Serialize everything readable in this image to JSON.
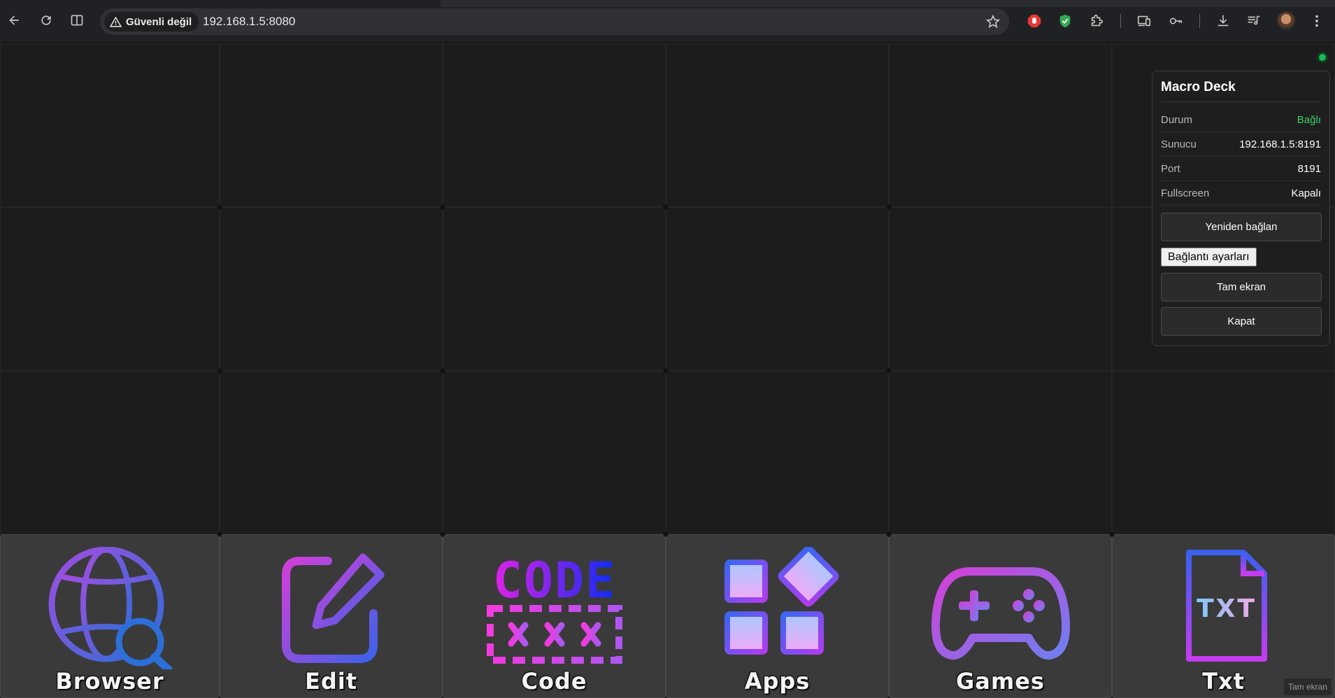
{
  "browser": {
    "security_label": "Güvenli değil",
    "url": "192.168.1.5:8080"
  },
  "deck": {
    "buttons": [
      {
        "label": "Browser",
        "icon": "globe-search-icon"
      },
      {
        "label": "Edit",
        "icon": "edit-icon"
      },
      {
        "label": "Code",
        "icon": "code-icon",
        "icon_text": "CODE"
      },
      {
        "label": "Apps",
        "icon": "apps-icon"
      },
      {
        "label": "Games",
        "icon": "gamepad-icon"
      },
      {
        "label": "Txt",
        "icon": "txt-file-icon",
        "icon_text": "TXT"
      }
    ]
  },
  "panel": {
    "title": "Macro Deck",
    "rows": [
      {
        "key": "Durum",
        "value": "Bağlı",
        "status_color": "#3ccf6a"
      },
      {
        "key": "Sunucu",
        "value": "192.168.1.5:8191"
      },
      {
        "key": "Port",
        "value": "8191"
      },
      {
        "key": "Fullscreen",
        "value": "Kapalı"
      }
    ],
    "reconnect_label": "Yeniden bağlan",
    "settings_label": "Bağlantı ayarları",
    "fullscreen_label": "Tam ekran",
    "close_label": "Kapat"
  },
  "fullscreen_badge": "Tam ekran",
  "colors": {
    "connected": "#1db954",
    "tile": "#3a3a3a",
    "background": "#1b1b1b"
  }
}
